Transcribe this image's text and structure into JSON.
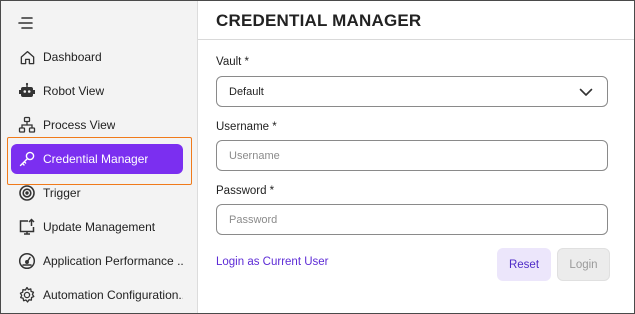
{
  "sidebar": {
    "menu_icon": "hamburger-icon",
    "items": [
      {
        "label": "Dashboard",
        "icon": "home-icon"
      },
      {
        "label": "Robot View",
        "icon": "robot-icon"
      },
      {
        "label": "Process View",
        "icon": "process-tree-icon"
      },
      {
        "label": "Credential Manager",
        "icon": "key-icon",
        "active": true
      },
      {
        "label": "Trigger",
        "icon": "target-icon"
      },
      {
        "label": "Update Management",
        "icon": "update-icon"
      },
      {
        "label": "Application Performance ...",
        "icon": "gauge-icon"
      },
      {
        "label": "Automation Configuration...",
        "icon": "gear-icon"
      }
    ],
    "active_color": "#7b2ff0",
    "highlight_color": "#f07a1a"
  },
  "main": {
    "title": "CREDENTIAL MANAGER",
    "vault": {
      "label": "Vault *",
      "value": "Default"
    },
    "username": {
      "label": "Username *",
      "placeholder": "Username"
    },
    "password": {
      "label": "Password *",
      "placeholder": "Password"
    },
    "login_current_user": "Login as Current User",
    "reset_label": "Reset",
    "login_label": "Login"
  }
}
